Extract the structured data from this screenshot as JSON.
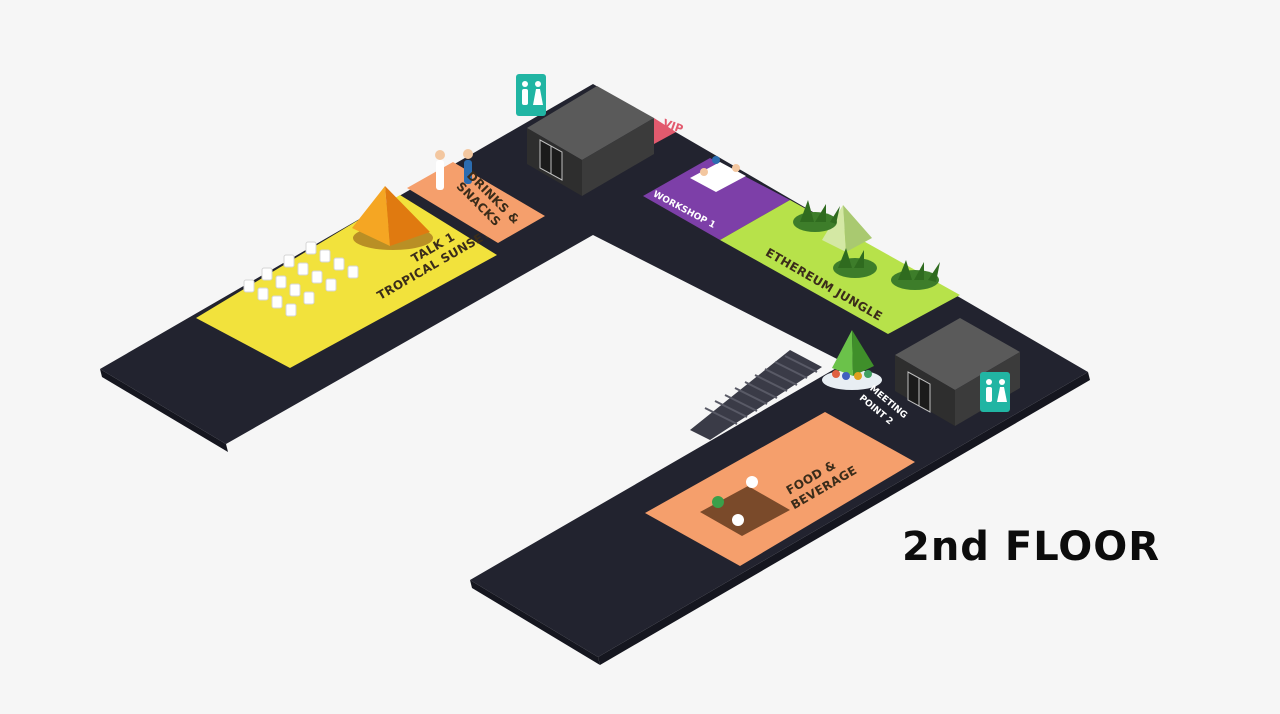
{
  "floor_title": "2nd FLOOR",
  "zones": {
    "talk": {
      "line1": "TALK 1",
      "line2": "TROPICAL SUNSET"
    },
    "drinks": {
      "line1": "DRINKS &",
      "line2": "SNACKS"
    },
    "workshop": {
      "label": "WORKSHOP 1"
    },
    "jungle": {
      "label": "ETHEREUM JUNGLE"
    },
    "meeting": {
      "line1": "MEETING",
      "line2": "POINT 2"
    },
    "food": {
      "line1": "FOOD &",
      "line2": "BEVERAGE"
    },
    "vip": {
      "label": "VIP"
    }
  },
  "colors": {
    "background": "#f6f6f6",
    "corridor": "#22232f",
    "talk_zone": "#f2e23c",
    "drinks_zone": "#f59f6c",
    "workshop_zone": "#7d3fa8",
    "jungle_zone": "#b7e24a",
    "food_zone": "#f59f6c",
    "restroom_sign": "#21b5a3",
    "elevator_box": "#3d3d3d",
    "vip_accent": "#e25a6e"
  },
  "icons": [
    "restroom-icon",
    "elevator-icon",
    "pyramid-icon",
    "plant-icon",
    "chair-icon",
    "table-icon",
    "stairs-icon",
    "people-icon"
  ]
}
